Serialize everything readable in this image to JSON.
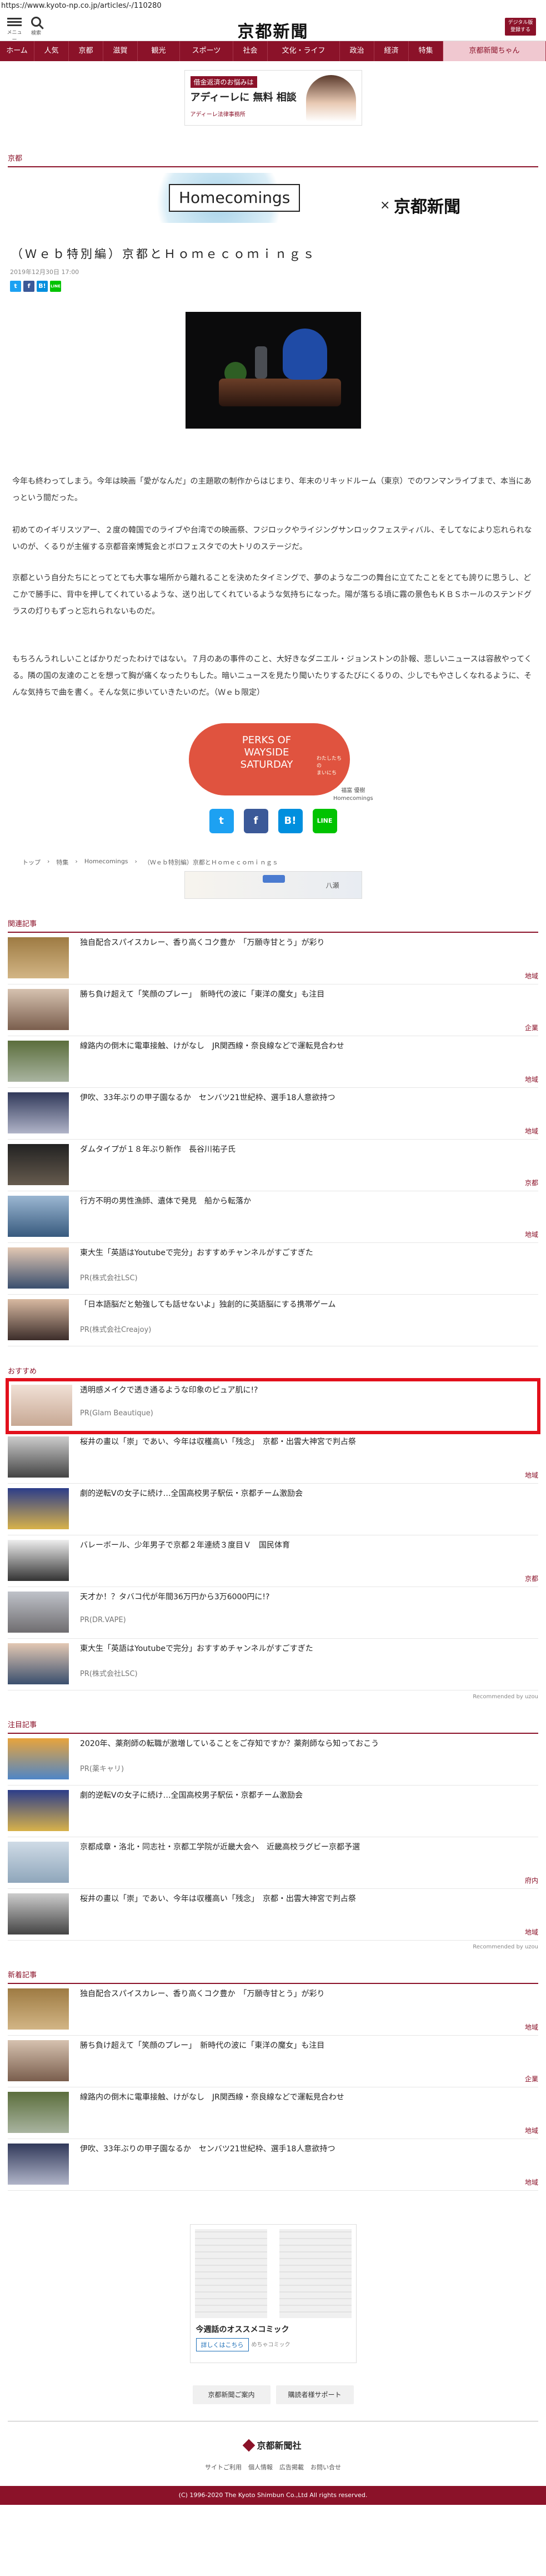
{
  "browser": {
    "url": "https://www.kyoto-np.co.jp/articles/-/110280"
  },
  "header": {
    "menu_label": "メニュー",
    "search_label": "検索",
    "logo": "京都新聞",
    "subscribe": "デジタル版\n登録する"
  },
  "nav": {
    "items": [
      "ホーム",
      "人気",
      "京都",
      "滋賀",
      "観光",
      "スポーツ",
      "社会",
      "文化・ライフ",
      "政治",
      "経済",
      "特集",
      "京都新聞ちゃん"
    ]
  },
  "ad_top": {
    "line1": "借金返済のお悩みは",
    "line2": "アディーレに 無料 相談",
    "line3": "アディーレ法律事務所"
  },
  "section_kyoto": "京都",
  "banner": {
    "brand": "Homecomings",
    "x": "×",
    "paper": "京都新聞"
  },
  "article": {
    "title": "（Ｗｅｂ特別編）京都とＨｏｍｅｃｏｍｉｎｇｓ",
    "date": "2019年12月30日 17:00",
    "paragraphs": [
      "今年も終わってしまう。今年は映画「愛がなんだ」の主題歌の制作からはじまり、年末のリキッドルーム（東京）でのワンマンライブまで、本当にあっという間だった。",
      "初めてのイギリスツアー、２度の韓国でのライブや台湾での映画祭、フジロックやライジングサンロックフェスティバル、そしてなにより忘れられないのが、くるりが主催する京都音楽博覧会とボロフェスタでの大トリのステージだ。",
      "京都という自分たちにとってとても大事な場所から離れることを決めたタイミングで、夢のような二つの舞台に立てたことをとても誇りに思うし、どこかで勝手に、背中を押してくれているような、送り出してくれているような気持ちになった。陽が落ちる頃に霧の景色もＫＢＳホールのステンドグラスの灯りもずっと忘れられないものだ。",
      "もちろんうれしいことばかりだったわけではない。７月のあの事件のこと、大好きなダニエル・ジョンストンの訃報、悲しいニュースは容赦やってくる。隣の国の友達のことを想って胸が痛くなったりもした。暗いニュースを見たり聞いたりするたびにくるりの、少しでもやさしくなれるように、そんな気持ちで曲を書く。そんな気に歩いていきたいのだ。（Ｗｅｂ限定）"
    ]
  },
  "illustration": {
    "text": "PERKS OF\nWAYSIDE SATURDAY",
    "sub": "わたしたちの\nまいにち",
    "credit": "福富 優樹\nHomecomings"
  },
  "share": {
    "twitter": "t",
    "facebook": "f",
    "hatena": "B!",
    "line": "LINE"
  },
  "breadcrumb": [
    "トップ",
    "特集",
    "Homecomings",
    "（Ｗｅｂ特別編）京都とＨｏｍｅｃｏｍｉｎｇｓ"
  ],
  "map_ad": {
    "text": "八瀬"
  },
  "related": {
    "heading": "関連記事",
    "items": [
      {
        "title": "独自配合スパイスカレー、香り高くコク豊か　「万願寺甘とう」が彩り",
        "category": "地域"
      },
      {
        "title": "勝ち負け超えて「笑顔のプレー」　新時代の波に「東洋の魔女」も注目",
        "category": "企業"
      },
      {
        "title": "線路内の倒木に電車接触、けがなし　JR関西線・奈良線などで運転見合わせ",
        "category": "地域"
      },
      {
        "title": "伊吹、33年ぶりの甲子園なるか　センバツ21世紀枠、選手18人意欲持つ",
        "category": "地域"
      },
      {
        "title": "ダムタイプが１８年ぶり新作　長谷川祐子氏",
        "category": "京都"
      },
      {
        "title": "行方不明の男性漁師、遺体で発見　船から転落か",
        "category": "地域"
      },
      {
        "title": "東大生「英語はYoutubeで完分」おすすめチャンネルがすごすぎた",
        "sub": "PR(株式会社LSC)"
      },
      {
        "title": "「日本語脳だと勉強しても話せないよ」独創的に英語脳にする携帯ゲーム",
        "sub": "PR(株式会社Creajoy)"
      }
    ]
  },
  "recommend": {
    "heading": "おすすめ",
    "items": [
      {
        "title": "透明感メイクで透き通るような印象のピュア肌に!?",
        "sub": "PR(Glam Beautique)"
      },
      {
        "title": "桜井の畫以「崇」であい、今年は収穫高い「残念」　京都・出雲大神宮で判占祭",
        "category": "地域"
      },
      {
        "title": "劇的逆転Vの女子に続け…全国高校男子駅伝・京都チーム激励会",
        "category": ""
      },
      {
        "title": "バレーボール、少年男子で京都２年連続３度目Ｖ　国民体育",
        "category": "京都"
      },
      {
        "title": "天才か！？タバコ代が年間36万円から3万6000円に!?",
        "sub": "PR(DR.VAPE)"
      },
      {
        "title": "東大生「英語はYoutubeで完分」おすすめチャンネルがすごすぎた",
        "sub": "PR(株式会社LSC)"
      }
    ],
    "credit": "Recommended by uzou"
  },
  "popular": {
    "heading": "注目記事",
    "items": [
      {
        "title": "2020年、薬剤師の転職が激増していることをご存知ですか？薬剤師なら知っておこう",
        "sub": "PR(薬キャリ)"
      },
      {
        "title": "劇的逆転Vの女子に続け…全国高校男子駅伝・京都チーム激励会",
        "category": ""
      },
      {
        "title": "京都成章・洛北・同志社・京都工学院が近畿大会へ　近畿高校ラグビー京都予選",
        "category": "府内"
      },
      {
        "title": "桜井の畫以「崇」であい、今年は収穫高い「残念」　京都・出雲大神宮で判占祭",
        "category": "地域"
      }
    ],
    "credit": "Recommended by uzou"
  },
  "latest": {
    "heading": "新着記事",
    "items": [
      {
        "title": "独自配合スパイスカレー、香り高くコク豊か　「万願寺甘とう」が彩り",
        "category": "地域"
      },
      {
        "title": "勝ち負け超えて「笑顔のプレー」　新時代の波に「東洋の魔女」も注目",
        "category": "企業"
      },
      {
        "title": "線路内の倒木に電車接触、けがなし　JR関西線・奈良線などで運転見合わせ",
        "category": "地域"
      },
      {
        "title": "伊吹、33年ぶりの甲子園なるか　センバツ21世紀枠、選手18人意欲持つ",
        "category": "地域"
      }
    ]
  },
  "manga_ad": {
    "title": "今週話のオススメコミック",
    "button": "詳しくはこちら",
    "source": "めちゃコミック"
  },
  "footer": {
    "buttons": [
      "京都新聞ご案内",
      "購読者様サポート"
    ],
    "logo": "京都新聞社",
    "links": [
      "サイトご利用",
      "個人情報",
      "広告掲載",
      "お問い合せ"
    ],
    "copyright": "(C) 1996-2020 The Kyoto Shimbun Co.,Ltd All rights reserved."
  }
}
